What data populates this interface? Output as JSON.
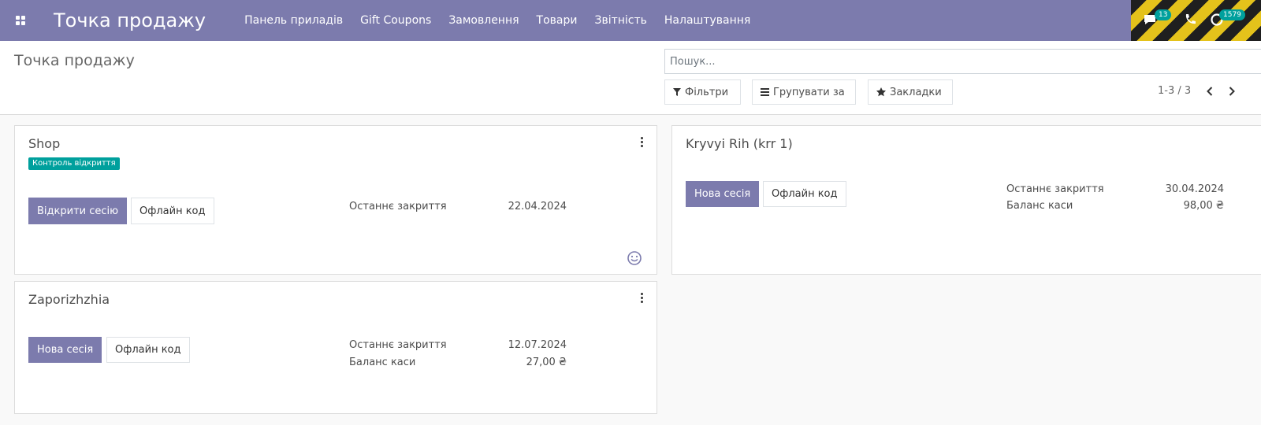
{
  "navbar": {
    "brand": "Точка продажу",
    "menu": [
      "Панель приладів",
      "Gift Coupons",
      "Замовлення",
      "Товари",
      "Звітність",
      "Налаштування"
    ],
    "messages_badge": "13",
    "activity_badge": "1579",
    "accent_color": "#7c7bad"
  },
  "control_panel": {
    "title": "Точка продажу",
    "search_placeholder": "Пошук...",
    "filters_label": "Фільтри",
    "group_by_label": "Групувати за",
    "favorites_label": "Закладки",
    "pager": "1-3 / 3"
  },
  "cards": [
    {
      "title": "Shop",
      "tag": "Контроль відкриття",
      "primary_label": "Відкрити сесію",
      "secondary_label": "Офлайн код",
      "last_closing_label": "Останнє закриття",
      "last_closing_value": "22.04.2024"
    },
    {
      "title": "Kryvyi Rih (krr 1)",
      "primary_label": "Нова сесія",
      "secondary_label": "Офлайн код",
      "last_closing_label": "Останнє закриття",
      "last_closing_value": "30.04.2024",
      "balance_label": "Баланс каси",
      "balance_value": "98,00 ₴"
    },
    {
      "title": "Zaporizhzhia",
      "primary_label": "Нова сесія",
      "secondary_label": "Офлайн код",
      "last_closing_label": "Останнє закриття",
      "last_closing_value": "12.07.2024",
      "balance_label": "Баланс каси",
      "balance_value": "27,00 ₴"
    }
  ]
}
